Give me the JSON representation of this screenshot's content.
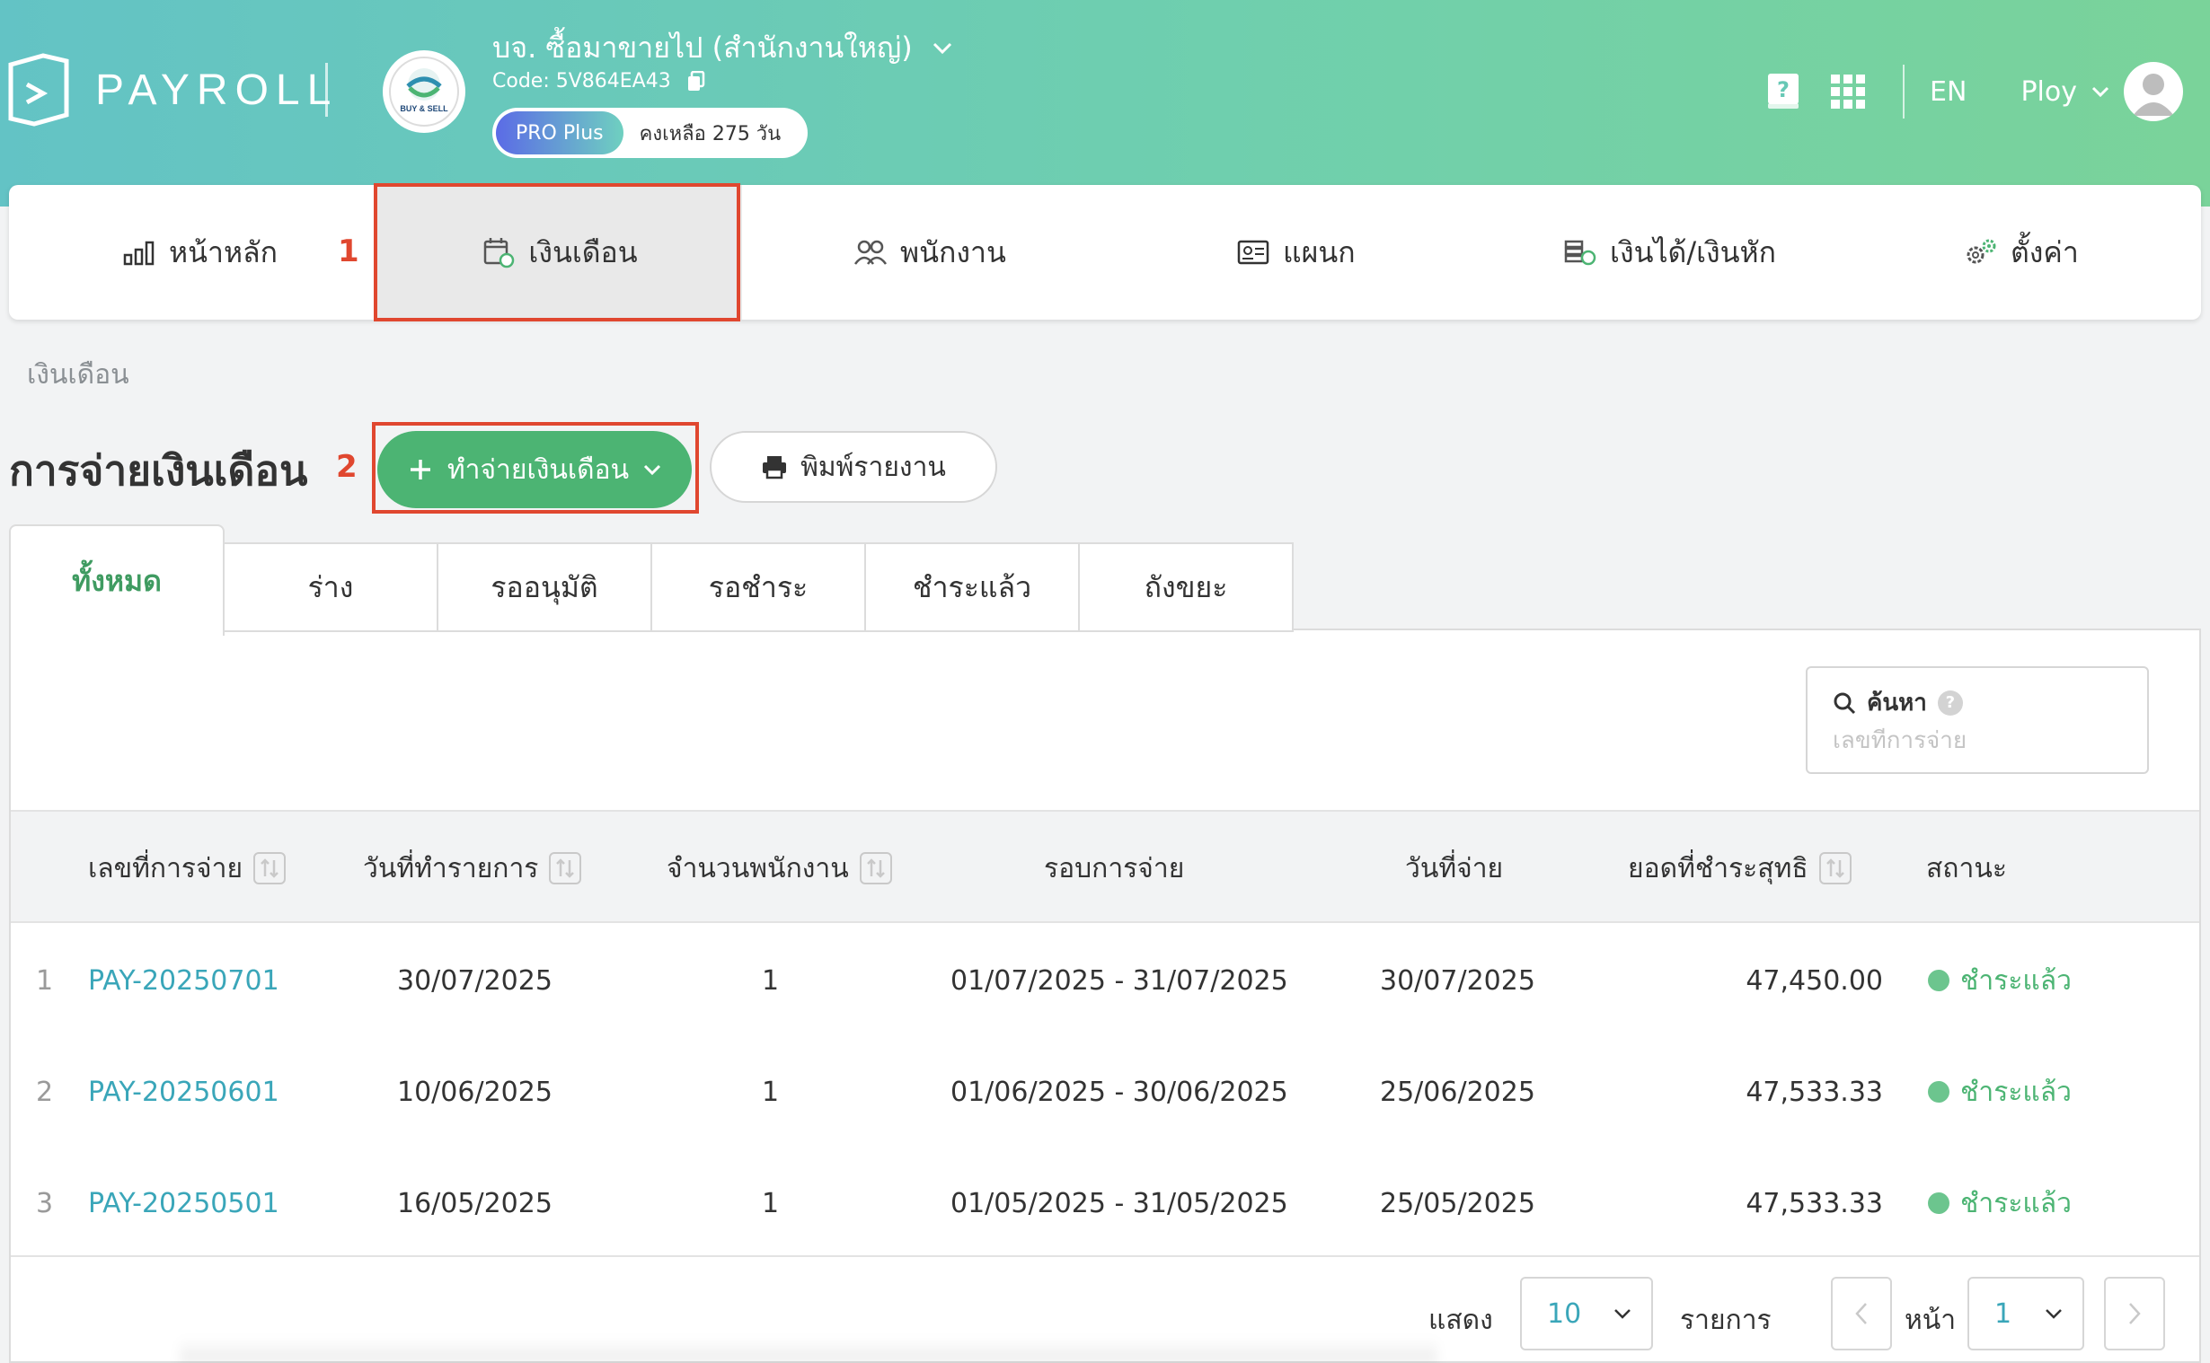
{
  "header": {
    "logo_text": "PAYROLL",
    "company_logo_text": "BUY & SELL",
    "company_name": "บจ. ซื้อมาขายไป (สำนักงานใหญ่)",
    "company_code": "Code: 5V864EA43",
    "plan": "PRO Plus",
    "plan_days": "คงเหลือ 275 วัน",
    "language": "EN",
    "user_name": "Ploy",
    "icons": [
      "help-book-icon",
      "apps-grid-icon",
      "copy-icon",
      "chevron-down-icon",
      "avatar-icon"
    ],
    "gradient": [
      "#63c3c5",
      "#7ad39a"
    ]
  },
  "nav": {
    "items": [
      {
        "label": "หน้าหลัก",
        "icon": "bar-chart-icon"
      },
      {
        "label": "เงินเดือน",
        "icon": "calendar-money-icon",
        "active": true
      },
      {
        "label": "พนักงาน",
        "icon": "users-icon"
      },
      {
        "label": "แผนก",
        "icon": "id-card-icon"
      },
      {
        "label": "เงินได้/เงินหัก",
        "icon": "money-stack-icon"
      },
      {
        "label": "ตั้งค่า",
        "icon": "gears-icon"
      }
    ]
  },
  "annotations": {
    "one": "1",
    "two": "2",
    "color": "#e0472f"
  },
  "breadcrumb": "เงินเดือน",
  "page": {
    "title": "การจ่ายเงินเดือน",
    "pay_button": "ทำจ่ายเงินเดือน",
    "print_button": "พิมพ์รายงาน"
  },
  "tabs": [
    "ทั้งหมด",
    "ร่าง",
    "รออนุมัติ",
    "รอชำระ",
    "ชำระแล้ว",
    "ถังขยะ"
  ],
  "search": {
    "label": "ค้นหา",
    "help": "?",
    "placeholder": "เลขที่การจ่าย"
  },
  "table": {
    "columns": [
      "เลขที่การจ่าย",
      "วันที่ทำรายการ",
      "จำนวนพนักงาน",
      "รอบการจ่าย",
      "วันที่จ่าย",
      "ยอดที่ชำระสุทธิ",
      "สถานะ"
    ],
    "rows": [
      {
        "no": "1",
        "id": "PAY-20250701",
        "created": "30/07/2025",
        "employees": "1",
        "period": "01/07/2025 - 31/07/2025",
        "pay_date": "30/07/2025",
        "net": "47,450.00",
        "status": "ชำระแล้ว"
      },
      {
        "no": "2",
        "id": "PAY-20250601",
        "created": "10/06/2025",
        "employees": "1",
        "period": "01/06/2025 - 30/06/2025",
        "pay_date": "25/06/2025",
        "net": "47,533.33",
        "status": "ชำระแล้ว"
      },
      {
        "no": "3",
        "id": "PAY-20250501",
        "created": "16/05/2025",
        "employees": "1",
        "period": "01/05/2025 - 31/05/2025",
        "pay_date": "25/05/2025",
        "net": "47,533.33",
        "status": "ชำระแล้ว"
      }
    ]
  },
  "pagination": {
    "show_label": "แสดง",
    "page_size": "10",
    "items_label": "รายการ",
    "page_label": "หน้า",
    "page": "1"
  }
}
